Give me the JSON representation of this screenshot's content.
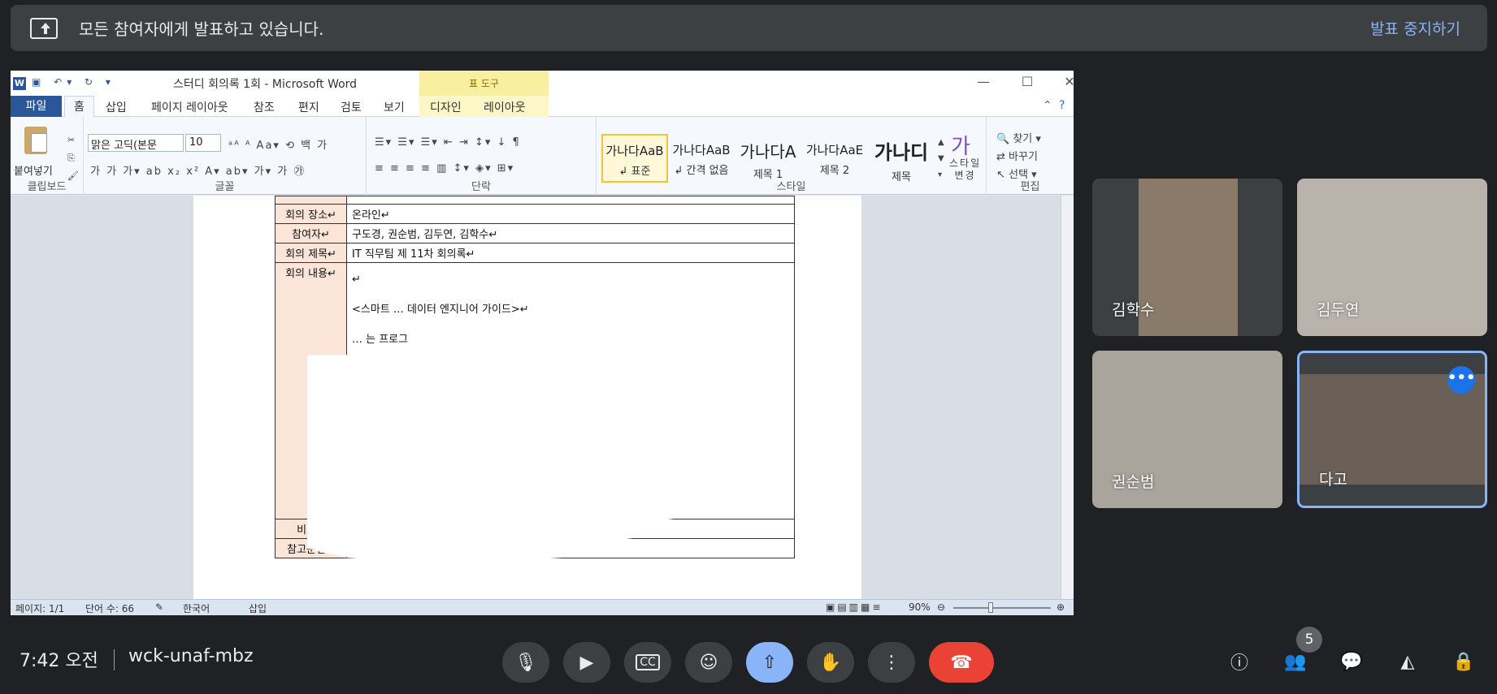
{
  "banner": {
    "text": "모든 참여자에게 발표하고 있습니다.",
    "stop": "발표 중지하기"
  },
  "word": {
    "title": "스터디 회의록 1회 - Microsoft Word",
    "table_tool": "표 도구",
    "tabs": [
      "파일",
      "홈",
      "삽입",
      "페이지 레이아웃",
      "참조",
      "편지",
      "검토",
      "보기",
      "디자인",
      "레이아웃"
    ],
    "groups": [
      "클립보드",
      "글꼴",
      "단락",
      "스타일",
      "편집"
    ],
    "paste": "붙여넣기",
    "font": "맑은 고딕(본문",
    "size": "10",
    "styles": [
      {
        "preview": "가나다AaB",
        "name": "↲ 표준"
      },
      {
        "preview": "가나다AaB",
        "name": "↲ 간격 없음"
      },
      {
        "preview": "가나다A",
        "name": "제목 1"
      },
      {
        "preview": "가나다AaE",
        "name": "제목 2"
      },
      {
        "preview": "가나디",
        "name": "제목"
      }
    ],
    "style_change": "스타일\n변경",
    "edit": {
      "find": "찾기",
      "replace": "바꾸기",
      "select": "선택"
    },
    "table": [
      {
        "label": "회의 장소↵",
        "value": "온라인↵"
      },
      {
        "label": "참여자↵",
        "value": "구도경, 권순범, 김두연, 김학수↵"
      },
      {
        "label": "회의 제목↵",
        "value": "IT 직무팀 제 11차 회의록↵"
      },
      {
        "label": "회의 내용↵",
        "value": "↵\n<스마트 … 데이터 엔지니어 가이드>↵\n… 는 프로그\n… 빅데이터 … 정↵\n↵\n<노션에 대해>↵"
      },
      {
        "label": "비고↵",
        "value": "↵"
      },
      {
        "label": "참고문헌↵",
        "value": "↵"
      }
    ],
    "status": {
      "page": "페이지: 1/1",
      "words": "단어 수: 66",
      "lang": "한국어",
      "mode": "삽입",
      "zoom": "90%"
    }
  },
  "participants": [
    {
      "name": "김학수",
      "bg": "#8a7a6a"
    },
    {
      "name": "김두연",
      "bg": "#b9b3ac"
    },
    {
      "name": "권순범",
      "bg": "#a9a49c"
    },
    {
      "name": "다고",
      "bg": "#6a6058"
    }
  ],
  "bottom": {
    "time": "7:42 오전",
    "code": "wck-unaf-mbz",
    "people_count": "5"
  }
}
